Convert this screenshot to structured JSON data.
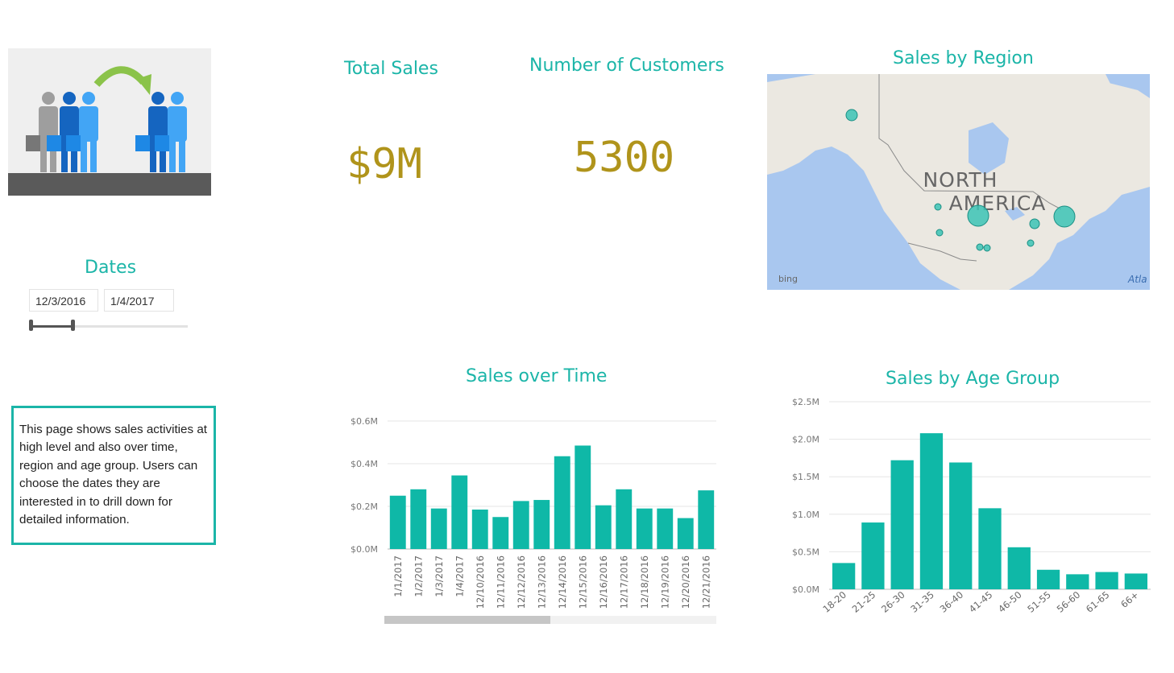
{
  "logo": {
    "icon": "people-transfer-illustration"
  },
  "dates_slicer": {
    "title": "Dates",
    "start": "12/3/2016",
    "end": "1/4/2017",
    "selected_fraction": [
      0,
      0.27
    ]
  },
  "kpis": {
    "total_sales": {
      "label": "Total Sales",
      "value": "$9M"
    },
    "customers": {
      "label": "Number of Customers",
      "value": "5300"
    }
  },
  "map": {
    "title": "Sales by Region",
    "region_label_line1": "NORTH",
    "region_label_line2": "AMERICA",
    "attribution": "bing",
    "ocean_label": "Atla"
  },
  "description": "This page shows sales activities at high level and also over time, region and age group. Users can choose the dates they are interested in to drill down for detailed information.",
  "colors": {
    "accent": "#1bb5a8",
    "bar": "#0fb8a7",
    "kpi": "#b0941b"
  },
  "chart_data": [
    {
      "type": "bar",
      "title": "Sales over Time",
      "categories": [
        "1/1/2017",
        "1/2/2017",
        "1/3/2017",
        "1/4/2017",
        "12/10/2016",
        "12/11/2016",
        "12/12/2016",
        "12/13/2016",
        "12/14/2016",
        "12/15/2016",
        "12/16/2016",
        "12/17/2016",
        "12/18/2016",
        "12/19/2016",
        "12/20/2016",
        "12/21/2016"
      ],
      "values": [
        0.25,
        0.28,
        0.19,
        0.345,
        0.185,
        0.15,
        0.225,
        0.23,
        0.435,
        0.485,
        0.205,
        0.28,
        0.19,
        0.19,
        0.145,
        0.275
      ],
      "y_ticks": [
        "$0.0M",
        "$0.2M",
        "$0.4M",
        "$0.6M"
      ],
      "ylim": [
        0,
        0.6
      ],
      "grid": true,
      "scrollbar_fraction": 0.5
    },
    {
      "type": "bar",
      "title": "Sales by Age Group",
      "categories": [
        "18-20",
        "21-25",
        "26-30",
        "31-35",
        "36-40",
        "41-45",
        "46-50",
        "51-55",
        "56-60",
        "61-65",
        "66+"
      ],
      "values": [
        0.35,
        0.89,
        1.72,
        2.08,
        1.69,
        1.08,
        0.56,
        0.26,
        0.2,
        0.23,
        0.21
      ],
      "y_ticks": [
        "$0.0M",
        "$0.5M",
        "$1.0M",
        "$1.5M",
        "$2.0M",
        "$2.5M"
      ],
      "ylim": [
        0,
        2.5
      ],
      "grid": true
    }
  ]
}
